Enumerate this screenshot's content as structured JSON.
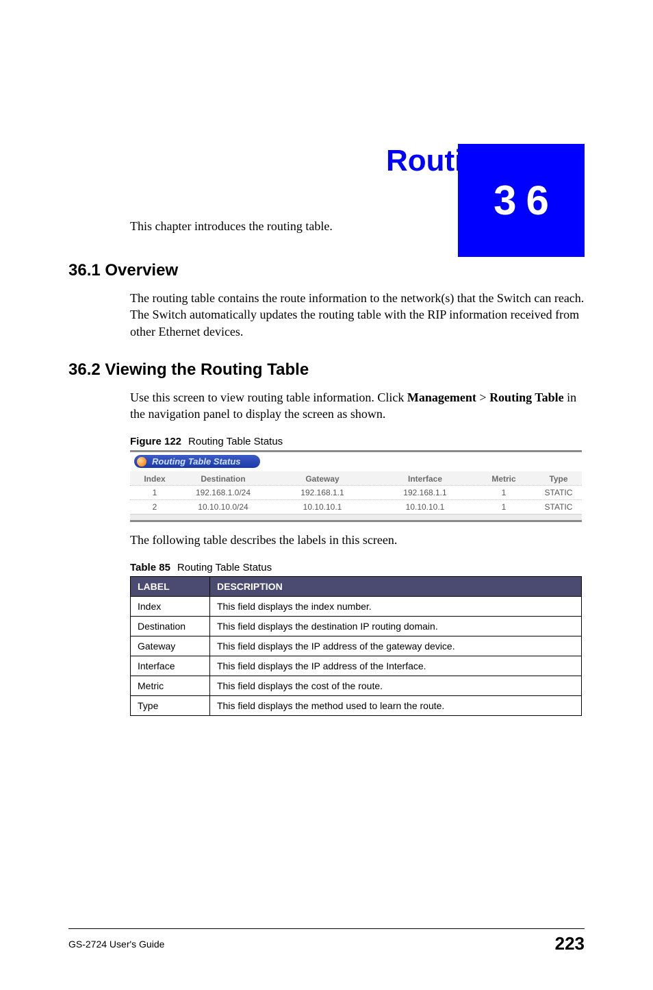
{
  "chapter": {
    "number": "36",
    "title": "Routing Table",
    "intro": "This chapter introduces the routing table."
  },
  "sections": {
    "overview": {
      "heading": "36.1  Overview",
      "body": "The routing table contains the route information to the network(s) that the Switch can reach. The Switch automatically updates the routing table with the RIP information received from other Ethernet devices."
    },
    "viewing": {
      "heading": "36.2  Viewing the Routing Table",
      "body_pre": "Use this screen to view routing table information. Click ",
      "nav1": "Management",
      "sep": " > ",
      "nav2": "Routing Table",
      "body_post": " in the navigation panel to display the screen as shown."
    }
  },
  "figure": {
    "label": "Figure 122",
    "caption": "Routing Table Status",
    "panel_title": "Routing Table Status",
    "columns": [
      "Index",
      "Destination",
      "Gateway",
      "Interface",
      "Metric",
      "Type"
    ],
    "rows": [
      {
        "index": "1",
        "destination": "192.168.1.0/24",
        "gateway": "192.168.1.1",
        "interface": "192.168.1.1",
        "metric": "1",
        "type": "STATIC"
      },
      {
        "index": "2",
        "destination": "10.10.10.0/24",
        "gateway": "10.10.10.1",
        "interface": "10.10.10.1",
        "metric": "1",
        "type": "STATIC"
      }
    ]
  },
  "post_figure_text": "The following table describes the labels in this screen.",
  "table": {
    "label": "Table 85",
    "caption": "Routing Table Status",
    "header": {
      "label": "LABEL",
      "description": "DESCRIPTION"
    },
    "rows": [
      {
        "label": "Index",
        "description": "This field displays the index number."
      },
      {
        "label": "Destination",
        "description": "This field displays the destination IP routing domain."
      },
      {
        "label": "Gateway",
        "description": "This field displays the IP address of the gateway device."
      },
      {
        "label": "Interface",
        "description": "This field displays the IP address of the Interface."
      },
      {
        "label": "Metric",
        "description": "This field displays the cost of the route."
      },
      {
        "label": "Type",
        "description": "This field displays the method used to learn the route."
      }
    ]
  },
  "footer": {
    "guide": "GS-2724 User's Guide",
    "page": "223"
  }
}
